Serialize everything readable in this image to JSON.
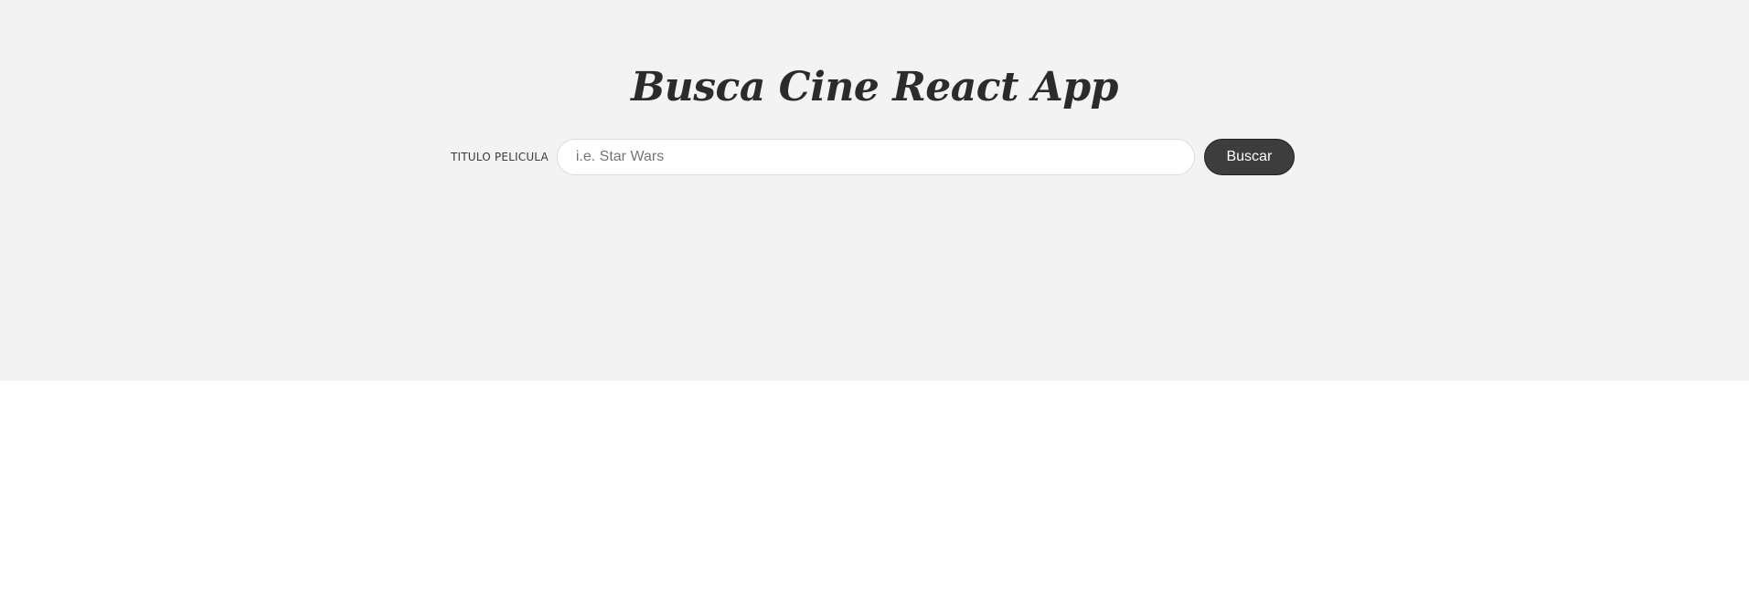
{
  "header": {
    "title": "Busca Cine React App"
  },
  "search": {
    "label": "TITULO PELICULA",
    "placeholder": "i.e. Star Wars",
    "value": "",
    "button_label": "Buscar"
  },
  "colors": {
    "hero_background": "#f3f3f3",
    "title_text": "#2b2b2b",
    "button_background": "#3d3d3d",
    "button_text": "#ffffff"
  }
}
